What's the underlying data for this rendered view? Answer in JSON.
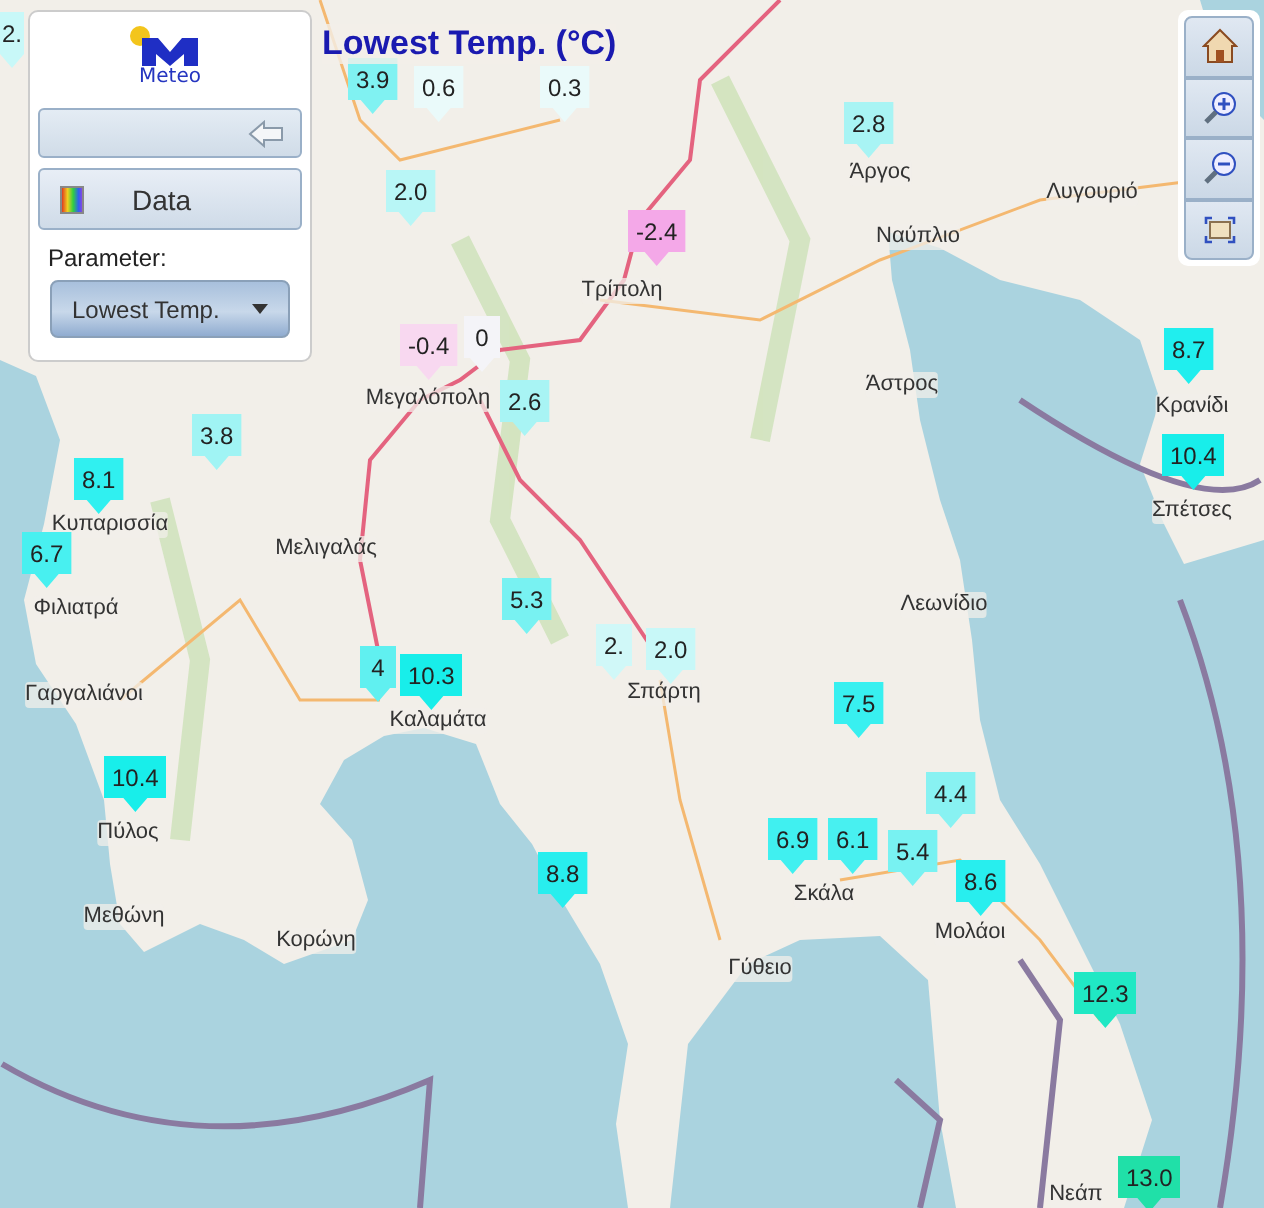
{
  "title": "Lowest Temp. (°C)",
  "panel": {
    "logo_text": "Meteo",
    "data_button": "Data",
    "parameter_label": "Parameter:",
    "parameter_value": "Lowest Temp."
  },
  "places": [
    "Τρίπολη",
    "Άργος",
    "Ναύπλιο",
    "Λυγουριό",
    "Άστρος",
    "Κρανίδι",
    "Σπέτσες",
    "Μεγαλόπολη",
    "Κυπαρισσία",
    "Μελιγαλάς",
    "Φιλιατρά",
    "Γαργαλιάνοι",
    "Καλαμάτα",
    "Σπάρτη",
    "Λεωνίδιο",
    "Πύλος",
    "Μεθώνη",
    "Κορώνη",
    "Γύθειο",
    "Σκάλα",
    "Μολάοι",
    "Νεάπ"
  ],
  "markers": [
    {
      "value": "2.",
      "color": "#c8f8f8"
    },
    {
      "value": "3.9",
      "color": "#80f2f2"
    },
    {
      "value": "0.6",
      "color": "#eafafa"
    },
    {
      "value": "0.3",
      "color": "#eafafa"
    },
    {
      "value": "2.0",
      "color": "#b8f6f6"
    },
    {
      "value": "2.8",
      "color": "#a8f4f4"
    },
    {
      "value": "-2.4",
      "color": "#f4a8e8"
    },
    {
      "value": "0",
      "color": "#f4f4f8"
    },
    {
      "value": "-0.4",
      "color": "#f8d8f0"
    },
    {
      "value": "2.6",
      "color": "#a8f4f4"
    },
    {
      "value": "8.7",
      "color": "#20eeee"
    },
    {
      "value": "10.4",
      "color": "#18eeea"
    },
    {
      "value": "3.8",
      "color": "#a0f4f4"
    },
    {
      "value": "8.1",
      "color": "#30f0f0"
    },
    {
      "value": "6.7",
      "color": "#48f0f0"
    },
    {
      "value": "5.3",
      "color": "#78f2f2"
    },
    {
      "value": "2.",
      "color": "#d0f8f8"
    },
    {
      "value": "2.0",
      "color": "#c8f8f8"
    },
    {
      "value": "4",
      "color": "#60f0f0"
    },
    {
      "value": "10.3",
      "color": "#18eeea"
    },
    {
      "value": "7.5",
      "color": "#38f0f0"
    },
    {
      "value": "10.4",
      "color": "#18eeea"
    },
    {
      "value": "4.4",
      "color": "#88f2f2"
    },
    {
      "value": "6.9",
      "color": "#40f0f0"
    },
    {
      "value": "6.1",
      "color": "#48f0f0"
    },
    {
      "value": "5.4",
      "color": "#78f2f2"
    },
    {
      "value": "8.6",
      "color": "#28eeee"
    },
    {
      "value": "8.8",
      "color": "#28eeee"
    },
    {
      "value": "12.3",
      "color": "#20e8c4"
    },
    {
      "value": "13.0",
      "color": "#20e0a8"
    }
  ]
}
